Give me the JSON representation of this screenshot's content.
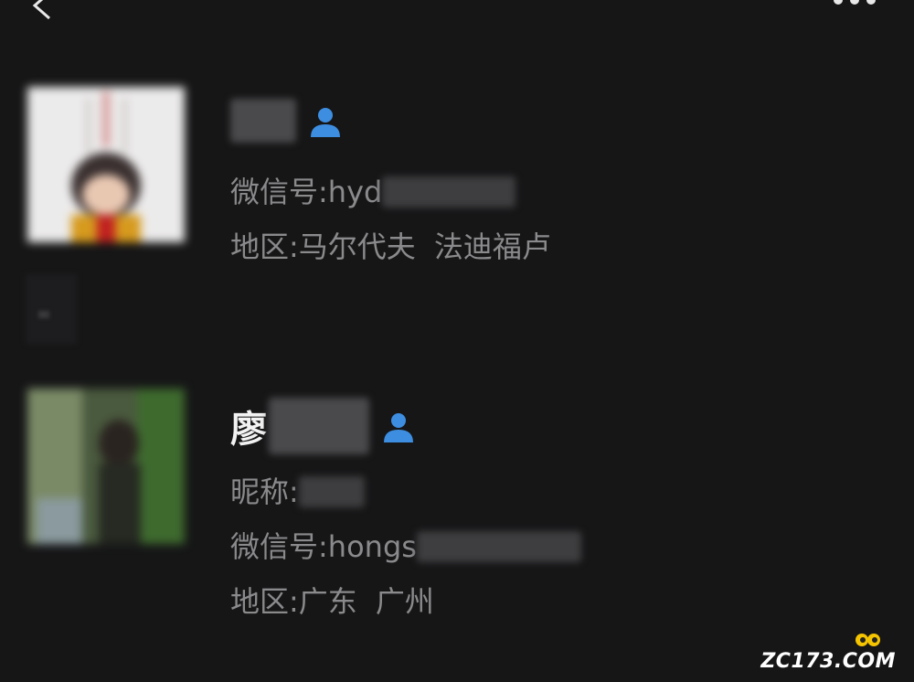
{
  "icons": {
    "back": "chevron-left-icon",
    "more": "more-dots-icon",
    "contact": "contact-person-icon"
  },
  "colors": {
    "background": "#161617",
    "primary_text": "#f2f2f2",
    "secondary_text": "#8a8a8c",
    "contact_icon": "#3d8ee0",
    "watermark_accent": "#f5c400"
  },
  "contacts": [
    {
      "name_prefix": "",
      "wechat_label": "微信号: ",
      "wechat_visible": "hyd",
      "region_label": "地区: ",
      "region_country": "马尔代夫",
      "region_city": "法迪福卢"
    },
    {
      "name_prefix": "廖",
      "nickname_label": "昵称: ",
      "wechat_label": "微信号: ",
      "wechat_visible": "hongs",
      "region_label": "地区: ",
      "region_country": "广东",
      "region_city": "广州"
    }
  ],
  "watermark": {
    "part1": "ZC173",
    "part2": ".C",
    "part3": "O",
    "part4": "M"
  }
}
